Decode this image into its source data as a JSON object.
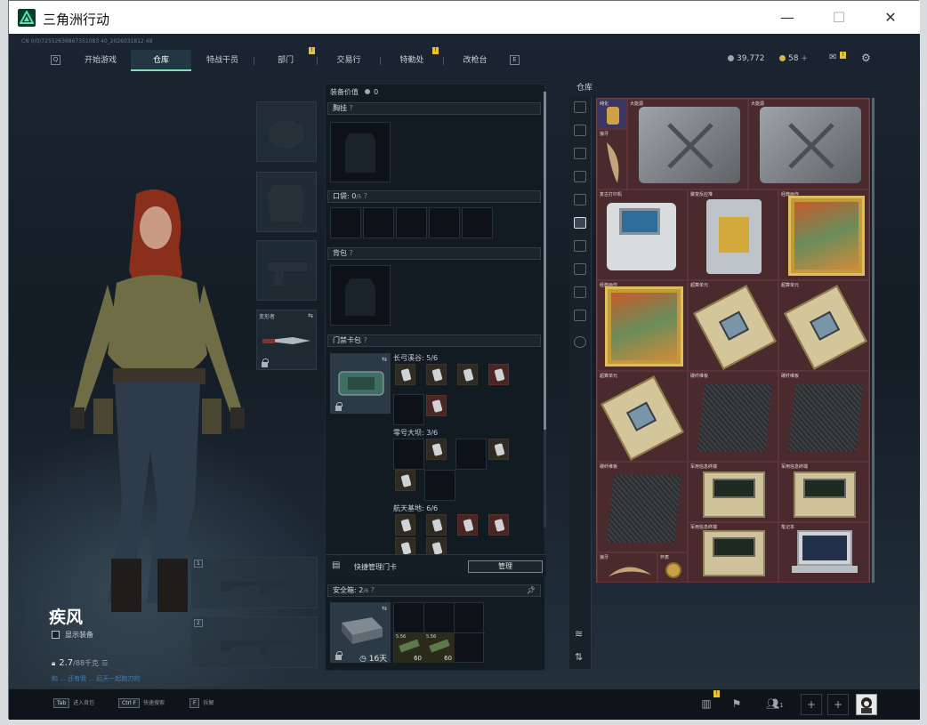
{
  "window": {
    "title": "三角洲行动",
    "minimize": "—",
    "maximize": "☐",
    "close": "✕"
  },
  "topline": "CN 0/0/72552636867351083 40_2026031812 48",
  "nav": {
    "prev_key": "Q",
    "next_key": "E",
    "tabs": [
      {
        "label": "开始游戏",
        "active": false
      },
      {
        "label": "仓库",
        "active": true
      },
      {
        "label": "特战干员",
        "active": false
      },
      {
        "label": "部门",
        "active": false,
        "badge": "!"
      },
      {
        "label": "交易行",
        "active": false
      },
      {
        "label": "特勤处",
        "active": false,
        "badge": "!"
      },
      {
        "label": "改枪台",
        "active": false
      }
    ]
  },
  "currency": {
    "silver": "39,772",
    "gold": "58",
    "add": "+"
  },
  "mail_badge": "!",
  "character": {
    "name": "疾风",
    "show_equipment": "显示装备",
    "weight": "2.7",
    "weight_cap": "/88千克",
    "tag": "和 ... 还有我 ... 后天一起跑刀的"
  },
  "gear": {
    "melee_label": "变形者"
  },
  "panel": {
    "equipment_value_label": "装备价值",
    "equipment_value": "0",
    "chest_rig": "胸挂",
    "pockets": "口袋",
    "pockets_count": "0",
    "pockets_cap": "/5",
    "backpack": "背包",
    "keycard_bag": "门禁卡包",
    "groups": [
      {
        "name": "长弓溪谷",
        "count": "5/6"
      },
      {
        "name": "零号大坝",
        "count": "3/6"
      },
      {
        "name": "航天基地",
        "count": "6/6"
      }
    ],
    "quick_manage_label": "快捷管理门卡",
    "manage_button": "管理",
    "safe_box": "安全箱",
    "safe_box_count": "2",
    "safe_box_cap": "/6",
    "safe_timer": "16天",
    "safe_items": [
      {
        "label": "60",
        "name": "5.56"
      },
      {
        "label": "60",
        "name": "5.56"
      }
    ]
  },
  "warehouse": {
    "title": "仓库",
    "items": [
      {
        "label": "纯化",
        "kind": "small"
      },
      {
        "label": "大能源",
        "kind": "gray"
      },
      {
        "label": "大能源",
        "kind": "gray"
      },
      {
        "label": "狼牙",
        "kind": "fang"
      },
      {
        "label": "复古打印机",
        "kind": "device"
      },
      {
        "label": "聚变反应堆",
        "kind": "reactor"
      },
      {
        "label": "经典画作",
        "kind": "painting"
      },
      {
        "label": "经典画作",
        "kind": "painting"
      },
      {
        "label": "超算单元",
        "kind": "board"
      },
      {
        "label": "超算单元",
        "kind": "board"
      },
      {
        "label": "超算单元",
        "kind": "board"
      },
      {
        "label": "碳纤维板",
        "kind": "carbon"
      },
      {
        "label": "碳纤维板",
        "kind": "carbon"
      },
      {
        "label": "碳纤维板",
        "kind": "carbon"
      },
      {
        "label": "军用信息终端",
        "kind": "laptop"
      },
      {
        "label": "军用信息终端",
        "kind": "laptop"
      },
      {
        "label": "军用信息终端",
        "kind": "laptop"
      },
      {
        "label": "笔记本",
        "kind": "notebook"
      },
      {
        "label": "狼牙",
        "kind": "fang"
      },
      {
        "label": "怀表",
        "kind": "watch"
      }
    ]
  },
  "bottom": {
    "hints": [
      {
        "key": "Tab",
        "label": "进入背包"
      },
      {
        "key": "Ctrl F",
        "label": "快速搜索"
      },
      {
        "key": "F",
        "label": "拆解"
      }
    ],
    "friends_count": "1",
    "plus": "+",
    "alert_badge": "!"
  },
  "colors": {
    "accent": "#7fe0b8",
    "warehouse_bg": "#4c2a2d",
    "badge": "#e4c33a"
  }
}
